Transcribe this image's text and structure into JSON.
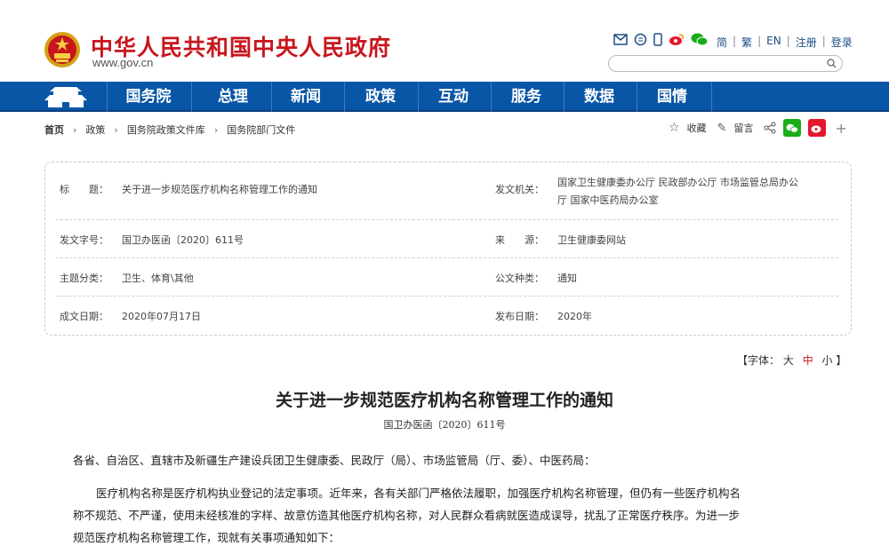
{
  "header": {
    "site_title": "中华人民共和国中央人民政府",
    "site_url": "www.gov.cn",
    "lang_links": [
      "简",
      "繁",
      "EN",
      "注册",
      "登录"
    ],
    "search_placeholder": ""
  },
  "nav": {
    "items": [
      "国务院",
      "总理",
      "新闻",
      "政策",
      "互动",
      "服务",
      "数据",
      "国情"
    ]
  },
  "breadcrumb": {
    "items": [
      "首页",
      "政策",
      "国务院政策文件库",
      "国务院部门文件"
    ]
  },
  "tools": {
    "favorite_label": "收藏",
    "comment_label": "留言",
    "plus": "+"
  },
  "info": {
    "title_label": "标　　题：",
    "title_value": "关于进一步规范医疗机构名称管理工作的通知",
    "issuer_label": "发文机关：",
    "issuer_value_line1": "国家卫生健康委办公厅  民政部办公厅  市场监管总局办公",
    "issuer_value_line2": "厅  国家中医药局办公室",
    "doc_no_label": "发文字号：",
    "doc_no_value": "国卫办医函〔2020〕611号",
    "source_label": "来　　源：",
    "source_value": "卫生健康委网站",
    "topic_label": "主题分类：",
    "topic_value": "卫生、体育\\其他",
    "type_label": "公文种类：",
    "type_value": "通知",
    "date_label": "成文日期：",
    "date_value": "2020年07月17日",
    "publish_label": "发布日期：",
    "publish_value": "2020年"
  },
  "font_size": {
    "prefix": "【字体：",
    "large": "大",
    "medium": "中",
    "small": "小",
    "suffix": "】"
  },
  "article": {
    "title": "关于进一步规范医疗机构名称管理工作的通知",
    "doc_no": "国卫办医函〔2020〕611号",
    "salutation": "各省、自治区、直辖市及新疆生产建设兵团卫生健康委、民政厅（局）、市场监管局（厅、委）、中医药局：",
    "para1_line1": "医疗机构名称是医疗机构执业登记的法定事项。近年来，各有关部门严格依法履职，加强医疗机构名称管理，但仍有一些医疗机构名",
    "para1_line2": "称不规范、不严谨，使用未经核准的字样、故意仿造其他医疗机构名称，对人民群众看病就医造成误导，扰乱了正常医疗秩序。为进一步",
    "para1_line3": "规范医疗机构名称管理工作，现就有关事项通知如下："
  },
  "colors": {
    "brand_red": "#c8161d",
    "nav_blue": "#0a56a6",
    "link_blue": "#1d4e89"
  }
}
